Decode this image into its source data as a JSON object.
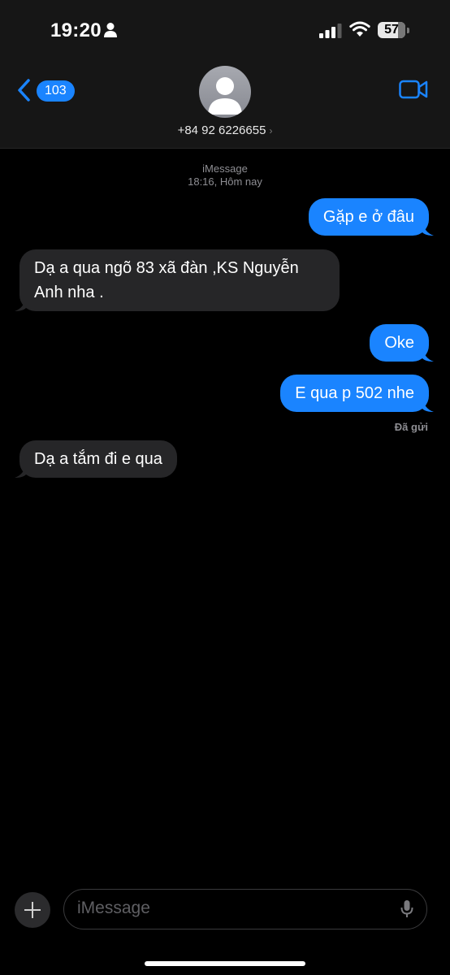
{
  "status_bar": {
    "time": "19:20",
    "battery": "57"
  },
  "header": {
    "unread_count": "103",
    "contact": "+84 92 6226655"
  },
  "conversation": {
    "service": "iMessage",
    "timestamp": "18:16, Hôm nay",
    "messages": [
      {
        "direction": "outgoing",
        "text": "Gặp e ở đâu"
      },
      {
        "direction": "incoming",
        "text": "Dạ a qua ngõ 83 xã  đàn ,KS Nguyễn Anh nha ."
      },
      {
        "direction": "outgoing",
        "text": "Oke"
      },
      {
        "direction": "outgoing",
        "text": "E qua p 502 nhe"
      },
      {
        "direction": "incoming",
        "text": "Dạ a tắm đi e qua"
      }
    ],
    "delivery_status": "Đã gửi"
  },
  "composer": {
    "placeholder": "iMessage"
  },
  "colors": {
    "outgoing_bubble": "#1a84ff",
    "incoming_bubble": "#262628",
    "accent": "#1a84ff"
  }
}
